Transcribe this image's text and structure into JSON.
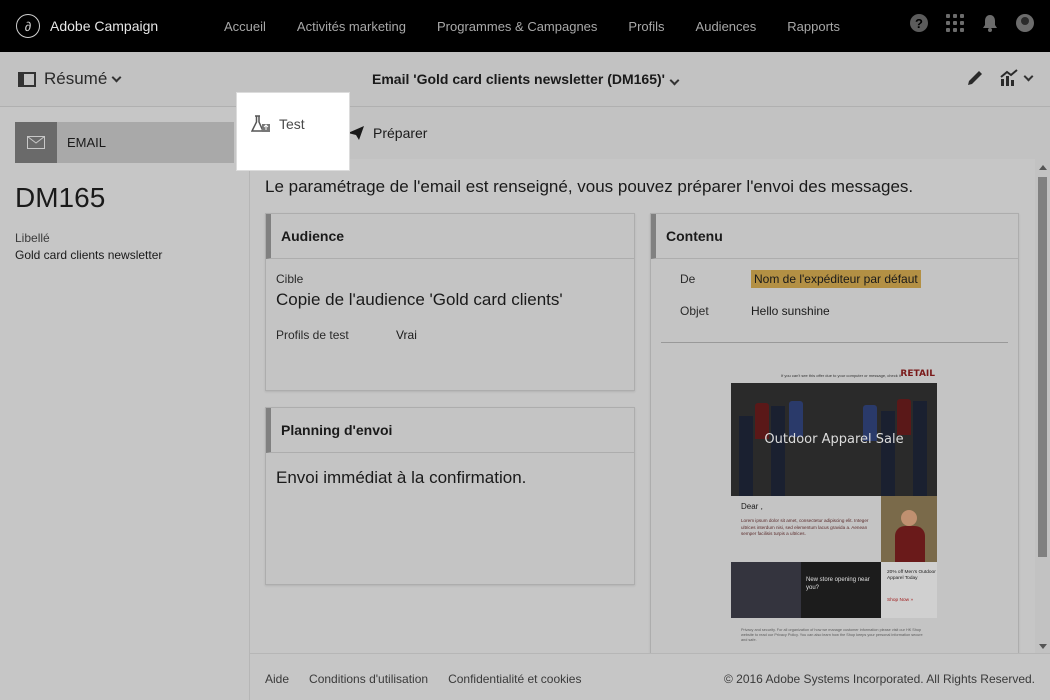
{
  "app": {
    "name": "Adobe Campaign"
  },
  "nav": {
    "items": [
      {
        "label": "Accueil"
      },
      {
        "label": "Activités marketing"
      },
      {
        "label": "Programmes & Campagnes"
      },
      {
        "label": "Profils"
      },
      {
        "label": "Audiences"
      },
      {
        "label": "Rapports"
      }
    ],
    "help_glyph": "?"
  },
  "subheader": {
    "view_selector": "Résumé",
    "title": "Email 'Gold card clients newsletter (DM165)'"
  },
  "left_panel": {
    "channel_label": "EMAIL",
    "code": "DM165",
    "label_caption": "Libellé",
    "label_value": "Gold card clients newsletter"
  },
  "actions": {
    "test_label": "Test",
    "prepare_label": "Préparer"
  },
  "main": {
    "info_message": "Le paramétrage de l'email est renseigné, vous pouvez préparer l'envoi des messages.",
    "audience": {
      "title": "Audience",
      "target_caption": "Cible",
      "target_value": "Copie de l'audience 'Gold card clients'",
      "test_profiles_caption": "Profils de test",
      "test_profiles_value": "Vrai"
    },
    "planning": {
      "title": "Planning d'envoi",
      "value": "Envoi immédiat à la confirmation."
    },
    "content": {
      "title": "Contenu",
      "from_caption": "De",
      "from_value": "Nom de l'expéditeur par défaut",
      "subject_caption": "Objet",
      "subject_value": "Hello sunshine",
      "preview": {
        "top_line": "If you can't see this offer due to your computer or message, check it",
        "logo": "RETAIL",
        "hero_title": "Outdoor Apparel Sale",
        "greeting": "Dear ,",
        "body": "Lorem ipsum dolor sit amet, consectetur adipiscing elit. Integer ultrices interdum nisi, sed elementum lacus gravida a. Aenean semper facilisis turpis a ultrices.",
        "store_text": "New store opening near you?",
        "offer_text": "20% off Men's Outdoor Apparel Today",
        "shop_now": "Shop Now »",
        "footer_text": "Privacy and security. For all organization of how we manage customer information please visit our HK Shop website to read our Privacy Policy. You can also learn how the Shop keeps your personal information secure and safe."
      }
    }
  },
  "footer": {
    "links": [
      {
        "label": "Aide"
      },
      {
        "label": "Conditions d'utilisation"
      },
      {
        "label": "Confidentialité et cookies"
      }
    ],
    "copyright": "© 2016 Adobe Systems Incorporated. All Rights Reserved."
  },
  "colors": {
    "topbar": "#000000",
    "overlay_gray": "#c6c6c6",
    "highlight": "#ffffff",
    "sender_badge": "#b39044"
  }
}
